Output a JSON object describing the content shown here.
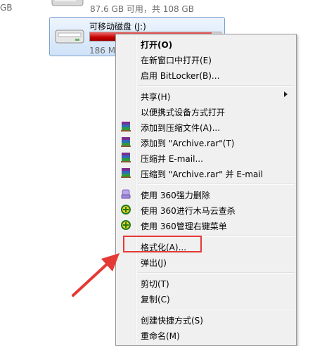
{
  "background": {
    "left_edge_text": "GB",
    "top_drive_text": "87.6 GB 可用，共 108 GB"
  },
  "drive": {
    "title": "可移动磁盘 (J:)",
    "info": "186 M",
    "usage_fraction": 0.93,
    "bar_color": "#c40000"
  },
  "context_menu": {
    "items": [
      {
        "label": "打开(O)"
      },
      {
        "label": "在新窗口中打开(E)"
      },
      {
        "label": "启用 BitLocker(B)..."
      },
      {
        "label": "共享(H)"
      },
      {
        "label": "以便携式设备方式打开"
      },
      {
        "label": "添加到压缩文件(A)...",
        "icon": "winrar-icon"
      },
      {
        "label": "添加到 \"Archive.rar\"(T)",
        "icon": "winrar-icon"
      },
      {
        "label": "压缩并 E-mail...",
        "icon": "winrar-icon"
      },
      {
        "label": "压缩到 \"Archive.rar\" 并 E-mail",
        "icon": "winrar-icon"
      },
      {
        "label": "使用 360强力删除",
        "icon": "360-shred-icon"
      },
      {
        "label": "使用 360进行木马云查杀",
        "icon": "360-shield-icon"
      },
      {
        "label": "使用 360管理右键菜单",
        "icon": "360-shield-icon"
      },
      {
        "label": "格式化(A)..."
      },
      {
        "label": "弹出(J)"
      },
      {
        "label": "剪切(T)"
      },
      {
        "label": "复制(C)"
      },
      {
        "label": "创建快捷方式(S)"
      },
      {
        "label": "重命名(M)"
      }
    ]
  },
  "colors": {
    "highlight_box": "#e53935",
    "annotation_arrow": "#e53935"
  }
}
